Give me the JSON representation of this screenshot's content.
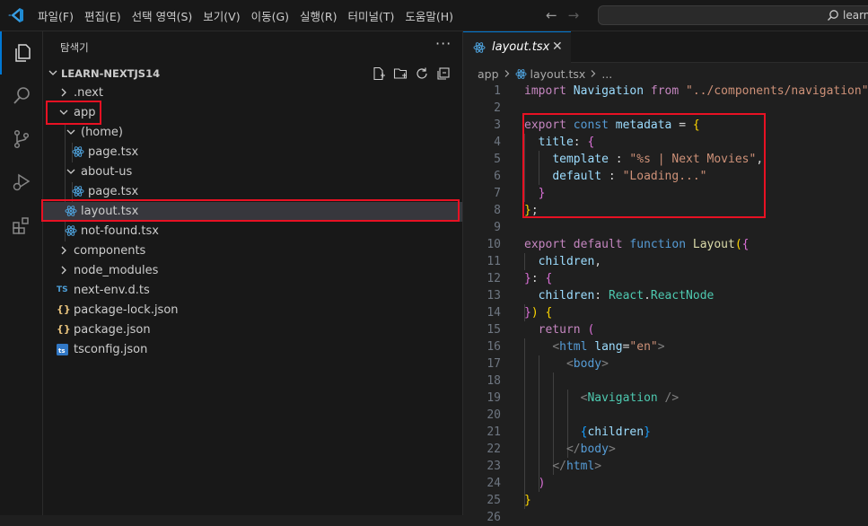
{
  "menu": [
    "파일(F)",
    "편집(E)",
    "선택 영역(S)",
    "보기(V)",
    "이동(G)",
    "실행(R)",
    "터미널(T)",
    "도움말(H)"
  ],
  "search": {
    "text": "learn"
  },
  "sidebar": {
    "title": "탐색기",
    "project": "LEARN-NEXTJS14",
    "more": "···",
    "tree": [
      {
        "label": ".next"
      },
      {
        "label": "app"
      },
      {
        "label": "(home)"
      },
      {
        "label": "page.tsx"
      },
      {
        "label": "about-us"
      },
      {
        "label": "page.tsx"
      },
      {
        "label": "layout.tsx"
      },
      {
        "label": "not-found.tsx"
      },
      {
        "label": "components"
      },
      {
        "label": "node_modules"
      },
      {
        "label": "next-env.d.ts"
      },
      {
        "label": "package-lock.json"
      },
      {
        "label": "package.json"
      },
      {
        "label": "tsconfig.json"
      }
    ],
    "ts_badge": "TS",
    "json_badge": "{}"
  },
  "editor": {
    "tab": {
      "name": "layout.tsx",
      "close": "✕"
    },
    "breadcrumb": {
      "folder": "app",
      "file": "layout.tsx",
      "rest": "..."
    },
    "line_numbers": [
      "1",
      "2",
      "3",
      "4",
      "5",
      "6",
      "7",
      "8",
      "9",
      "10",
      "11",
      "12",
      "13",
      "14",
      "15",
      "16",
      "17",
      "18",
      "19",
      "20",
      "21",
      "22",
      "23",
      "24",
      "25",
      "26"
    ],
    "code": {
      "l1": [
        "import",
        " Navigation ",
        "from",
        " \"../components/navigation\""
      ],
      "l3": [
        "export",
        " const ",
        "metadata",
        " = ",
        "{"
      ],
      "l4": [
        "title",
        ": ",
        "{"
      ],
      "l5": [
        "template",
        " : ",
        "\"%s | Next Movies\"",
        ","
      ],
      "l6": [
        "default",
        " : ",
        "\"Loading...\""
      ],
      "l7": [
        "}"
      ],
      "l8": [
        "}",
        ";"
      ],
      "l10": [
        "export",
        " default ",
        "function",
        " ",
        "Layout",
        "(",
        "{"
      ],
      "l11": [
        "children",
        ","
      ],
      "l12": [
        "}",
        ": ",
        "{"
      ],
      "l13": [
        "children",
        ": ",
        "React",
        ".",
        "ReactNode"
      ],
      "l14": [
        "}",
        ")",
        " ",
        "{"
      ],
      "l15": [
        "return",
        " ",
        "("
      ],
      "l16": [
        "<",
        "html",
        " lang",
        "=",
        "\"en\"",
        ">"
      ],
      "l17": [
        "<",
        "body",
        ">"
      ],
      "l19": [
        "<",
        "Navigation",
        " />"
      ],
      "l21": [
        "{",
        "children",
        "}"
      ],
      "l22": [
        "</",
        "body",
        ">"
      ],
      "l23": [
        "</",
        "html",
        ">"
      ],
      "l24": [
        ")"
      ],
      "l25": [
        "}"
      ]
    }
  },
  "colors": {
    "accent": "#0078d4",
    "highlight": "#e81123"
  }
}
